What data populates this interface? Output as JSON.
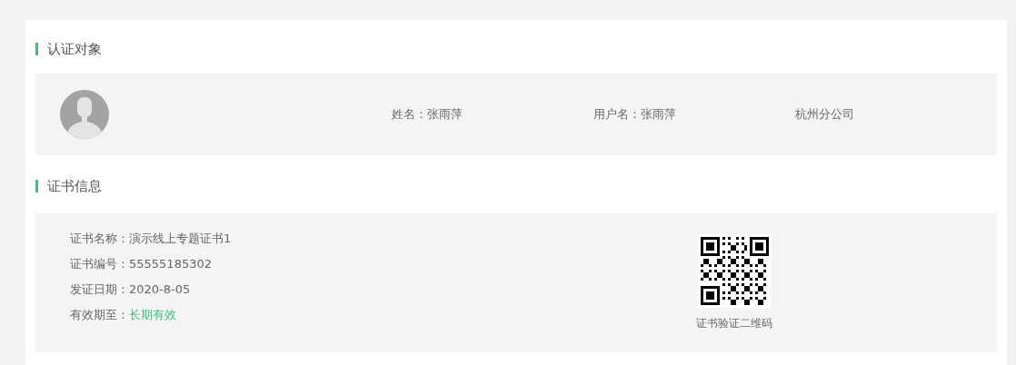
{
  "subject_section": {
    "title": "认证对象",
    "avatar": {
      "kind": "placeholder"
    },
    "fields": [
      {
        "label": "姓名：",
        "value": "张雨萍"
      },
      {
        "label": "用户名：",
        "value": "张雨萍"
      },
      {
        "value": "杭州分公司"
      }
    ]
  },
  "certificate_section": {
    "title": "证书信息",
    "fields": [
      {
        "label": "证书名称：",
        "value": "演示线上专题证书1",
        "kind": "text"
      },
      {
        "label": "证书编号：",
        "value": "55555185302",
        "kind": "text"
      },
      {
        "label": "发证日期：",
        "value": "2020-8-05",
        "kind": "text"
      },
      {
        "label": "有效期至：",
        "value": "长期有效",
        "kind": "status"
      }
    ],
    "qr_caption": "证书验证二维码"
  }
}
